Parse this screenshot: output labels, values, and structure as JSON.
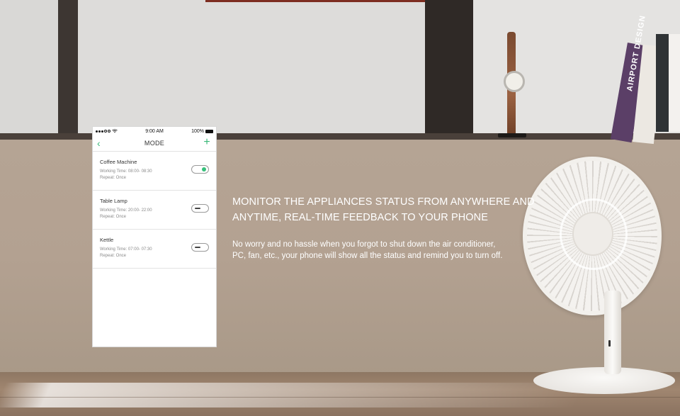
{
  "background": {
    "book_spine_text": "AIRPORT DESIGN"
  },
  "phone": {
    "status_bar": {
      "time": "9:00 AM",
      "battery": "100%"
    },
    "nav": {
      "title": "MODE",
      "back_icon": "chevron-left-icon",
      "add_icon": "plus-icon"
    },
    "items": [
      {
        "name": "Coffee Machine",
        "working_time": "Working Time: 08:00- 08:30",
        "repeat": "Repeat: Once",
        "enabled": true
      },
      {
        "name": "Table Lamp",
        "working_time": "Working Time:  20:00- 22:00",
        "repeat": "Repeat: Once",
        "enabled": false
      },
      {
        "name": "Kettle",
        "working_time": "Working Time: 07:00- 07:30",
        "repeat": "Repeat: Once",
        "enabled": false
      }
    ],
    "accent_color": "#37c07b"
  },
  "copy": {
    "headline_line1": "MONITOR THE APPLIANCES STATUS FROM ANYWHERE AND",
    "headline_line2": "ANYTIME, REAL-TIME FEEDBACK TO YOUR PHONE",
    "body_line1": "No worry and no hassle when you forgot to shut down the air conditioner,",
    "body_line2": "PC, fan, etc., your phone will show all the status and remind you to turn off."
  }
}
